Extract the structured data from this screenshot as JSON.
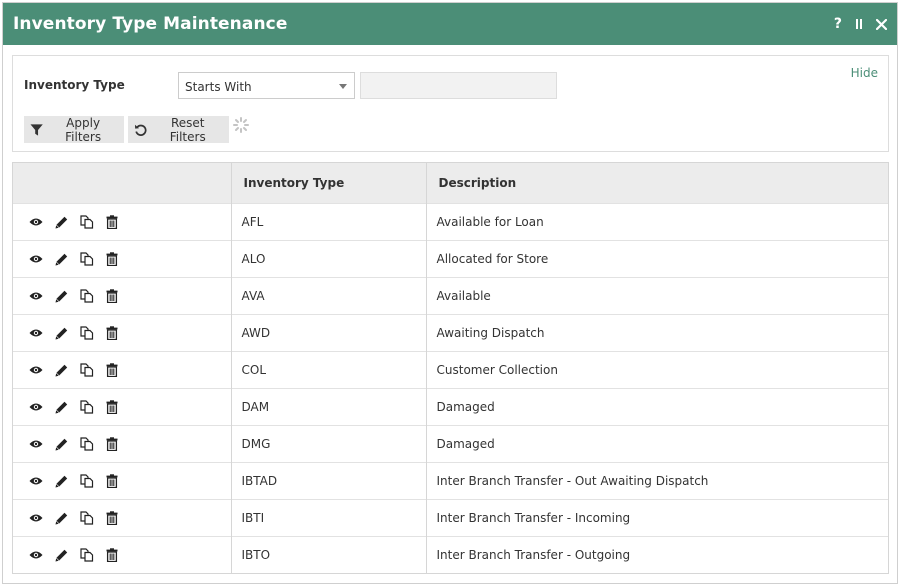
{
  "window": {
    "title": "Inventory Type Maintenance",
    "help_label": "?",
    "accent_color": "#4b8e77"
  },
  "filters": {
    "field_label": "Inventory Type",
    "operator_selected": "Starts With",
    "value": "",
    "hide_label": "Hide",
    "apply_label": "Apply Filters",
    "reset_label": "Reset Filters"
  },
  "grid": {
    "columns": [
      "",
      "Inventory Type",
      "Description"
    ],
    "row_actions": [
      "view-icon",
      "edit-icon",
      "copy-icon",
      "delete-icon"
    ],
    "rows": [
      {
        "code": "AFL",
        "description": "Available for Loan"
      },
      {
        "code": "ALO",
        "description": "Allocated for Store"
      },
      {
        "code": "AVA",
        "description": "Available"
      },
      {
        "code": "AWD",
        "description": "Awaiting Dispatch"
      },
      {
        "code": "COL",
        "description": "Customer Collection"
      },
      {
        "code": "DAM",
        "description": "Damaged"
      },
      {
        "code": "DMG",
        "description": "Damaged"
      },
      {
        "code": "IBTAD",
        "description": "Inter Branch Transfer - Out Awaiting Dispatch"
      },
      {
        "code": "IBTI",
        "description": "Inter Branch Transfer - Incoming"
      },
      {
        "code": "IBTO",
        "description": "Inter Branch Transfer - Outgoing"
      }
    ]
  }
}
